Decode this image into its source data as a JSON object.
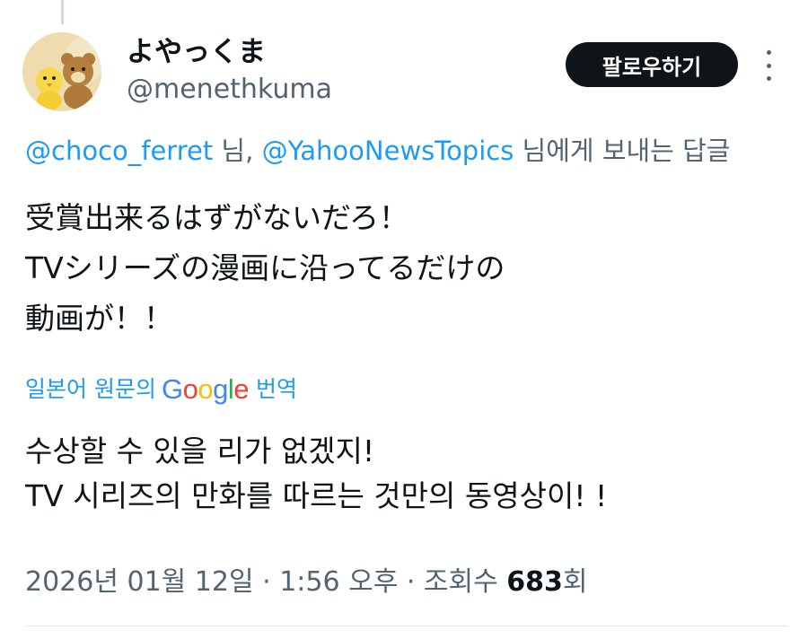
{
  "user": {
    "display_name": "よやっくま",
    "handle": "@menethkuma",
    "avatar_icon": "bear-and-chick-plush-avatar"
  },
  "follow_button": {
    "label": "팔로우하기"
  },
  "more_icon": "more-vertical-icon",
  "reply_to": {
    "mention_1": "@choco_ferret",
    "separator": " 님, ",
    "mention_2": "@YahooNewsTopics",
    "suffix": " 님에게 보내는 답글"
  },
  "tweet": {
    "lines": [
      "受賞出来るはずがないだろ！",
      "TVシリーズの漫画に沿ってるだけの",
      "動画が！！"
    ]
  },
  "translation": {
    "prefix": "일본어 원문의",
    "google": {
      "G": "G",
      "o1": "o",
      "o2": "o",
      "g": "g",
      "l": "l",
      "e": "e"
    },
    "suffix": "번역",
    "lines": [
      "수상할 수 있을 리가 없겠지!",
      "TV 시리즈의 만화를 따르는 것만의 동영상이! !"
    ]
  },
  "meta": {
    "date": "2026년 01월 12일",
    "sep1": " · ",
    "time": "1:56 오후",
    "sep2": " · ",
    "views_label": "조회수 ",
    "views_count": "683",
    "views_suffix": "회"
  },
  "colors": {
    "link_blue": "#1d9bf0",
    "text_primary": "#0f1419",
    "text_secondary": "#536471",
    "button_bg": "#0f1419"
  }
}
